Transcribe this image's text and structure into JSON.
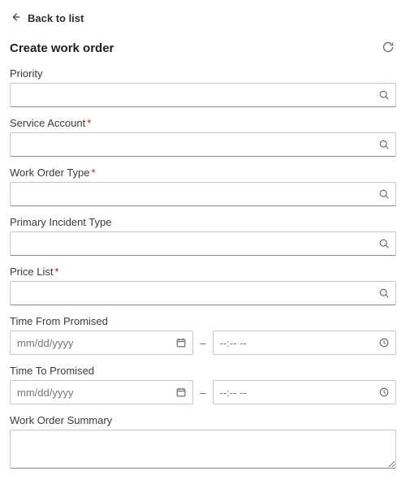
{
  "back_label": "Back to list",
  "title": "Create work order",
  "required_mark": "*",
  "dash": "–",
  "date_placeholder": "mm/dd/yyyy",
  "time_placeholder": "--:-- --",
  "fields": {
    "priority": {
      "label": "Priority",
      "value": ""
    },
    "service_account": {
      "label": "Service Account",
      "value": ""
    },
    "work_order_type": {
      "label": "Work Order Type",
      "value": ""
    },
    "primary_incident_type": {
      "label": "Primary Incident Type",
      "value": ""
    },
    "price_list": {
      "label": "Price List",
      "value": ""
    },
    "time_from_promised": {
      "label": "Time From Promised",
      "date": "",
      "time": ""
    },
    "time_to_promised": {
      "label": "Time To Promised",
      "date": "",
      "time": ""
    },
    "work_order_summary": {
      "label": "Work Order Summary",
      "value": ""
    }
  }
}
